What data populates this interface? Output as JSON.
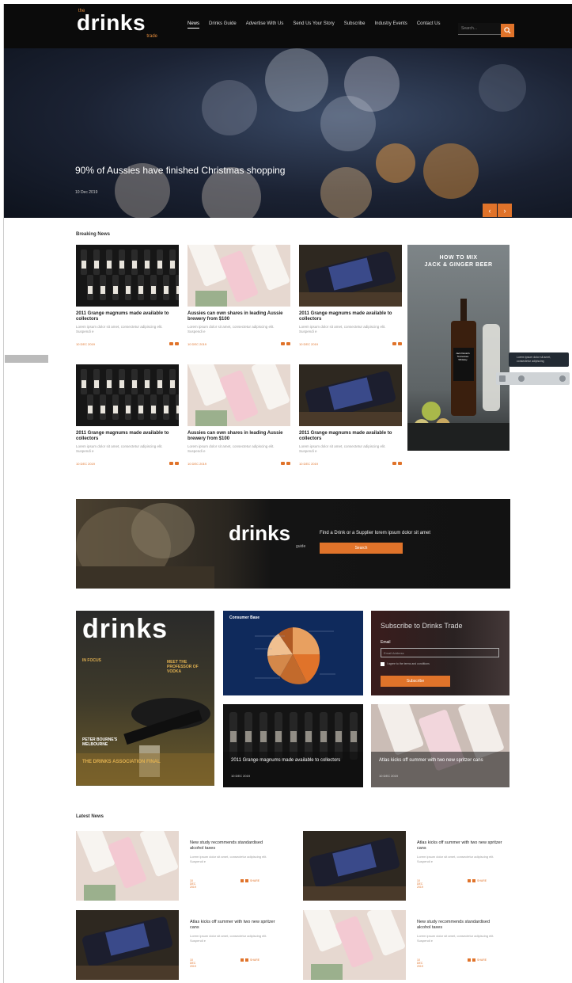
{
  "header": {
    "logo_word": "drinks",
    "logo_the": "the",
    "logo_trade": "trade",
    "nav": [
      {
        "label": "News",
        "active": true
      },
      {
        "label": "Drinks Guide"
      },
      {
        "label": "Advertise With Us"
      },
      {
        "label": "Send Us Your Story"
      },
      {
        "label": "Subscribe"
      },
      {
        "label": "Industry Events"
      },
      {
        "label": "Contact Us"
      }
    ],
    "search_placeholder": "Search..."
  },
  "hero": {
    "title": "90% of Aussies have finished Christmas shopping",
    "date": "10 Dec 2019",
    "prev": "‹",
    "next": "›"
  },
  "breaking": {
    "label": "Breaking News",
    "cards": [
      {
        "title": "2011 Grange magnums made available to collectors",
        "excerpt": "Lorem ipsum dolor sit amet, consectetur adipiscing elit. Suspendi e",
        "date": "10 DEC 2019",
        "img": "bottles"
      },
      {
        "title": "Aussies can own shares in leading Aussie brewery from $100",
        "excerpt": "Lorem ipsum dolor sit amet, consectetur adipiscing elit. Suspendi e",
        "date": "10 DEC 2019",
        "img": "pink"
      },
      {
        "title": "2011 Grange magnums made available to collectors",
        "excerpt": "Lorem ipsum dolor sit amet, consectetur adipiscing elit. Suspendi e",
        "date": "10 DEC 2019",
        "img": "dark-bottle"
      },
      {
        "title": "2011 Grange magnums made available to collectors",
        "excerpt": "Lorem ipsum dolor sit amet, consectetur adipiscing elit. Suspendi e",
        "date": "10 DEC 2019",
        "img": "bottles"
      },
      {
        "title": "Aussies can own shares in leading Aussie brewery from $100",
        "excerpt": "Lorem ipsum dolor sit amet, consectetur adipiscing elit. Suspendi e",
        "date": "10 DEC 2019",
        "img": "pink"
      },
      {
        "title": "2011 Grange magnums made available to collectors",
        "excerpt": "Lorem ipsum dolor sit amet, consectetur adipiscing elit. Suspendi e",
        "date": "10 DEC 2019",
        "img": "dark-bottle"
      }
    ]
  },
  "ad": {
    "title_line1": "HOW TO MIX",
    "title_line2": "JACK & GINGER BEER",
    "label_brand": "Jack Daniel's",
    "label_sub": "Tennessee Whiskey"
  },
  "tooltip": {
    "text": "Lorem ipsum dolor sit amet, consectetur adipiscing"
  },
  "guide_banner": {
    "logo": "drinks",
    "sub": "guide",
    "text": "Find a Drink or a Supplier lorem ipsum dolor sit amet",
    "button": "Search"
  },
  "magazine": {
    "title": "drinks",
    "line1": "IN FOCUS",
    "line2": "MEET THE PROFESSOR OF VODKA",
    "line3": "PETER BOURNE'S MELBOURNE",
    "line4": "THE DRINKS ASSOCIATION FINAL"
  },
  "consumer": {
    "title": "Consumer Base"
  },
  "subscribe": {
    "title": "Subscribe to Drinks Trade",
    "email_label": "Email",
    "email_placeholder": "Email Address",
    "checkbox_label": "I agree to the terms and conditions",
    "button": "Subscribe"
  },
  "feature_tiles": [
    {
      "title": "2011 Grange magnums made available to collectors",
      "date": "10 DEC 2019"
    },
    {
      "title": "Atlas kicks off summer with two new spritzer cans",
      "date": "10 DEC 2019"
    }
  ],
  "latest": {
    "label": "Latest News",
    "items": [
      {
        "title": "New study recommends standardised alcohol taxes",
        "excerpt": "Lorem ipsum dolor sit amet, consectetur adipiscing elit. Suspendi e",
        "date": "10 DEC 2019",
        "share": "SHARE",
        "img": "pink"
      },
      {
        "title": "Atlas kicks off summer with two new spritzer cans",
        "excerpt": "Lorem ipsum dolor sit amet, consectetur adipiscing elit. Suspendi e",
        "date": "10 DEC 2019",
        "share": "SHARE",
        "img": "dark-bottle"
      },
      {
        "title": "Atlas kicks off summer with two new spritzer cans",
        "excerpt": "Lorem ipsum dolor sit amet, consectetur adipiscing elit. Suspendi e",
        "date": "10 DEC 2019",
        "share": "SHARE",
        "img": "dark-bottle"
      },
      {
        "title": "New study recommends standardised alcohol taxes",
        "excerpt": "Lorem ipsum dolor sit amet, consectetur adipiscing elit. Suspendi e",
        "date": "10 DEC 2019",
        "share": "SHARE",
        "img": "pink"
      }
    ]
  },
  "colors": {
    "accent": "#e0732a",
    "header_bg": "#0b0b0b",
    "chart_bg": "#0f2a5c"
  }
}
